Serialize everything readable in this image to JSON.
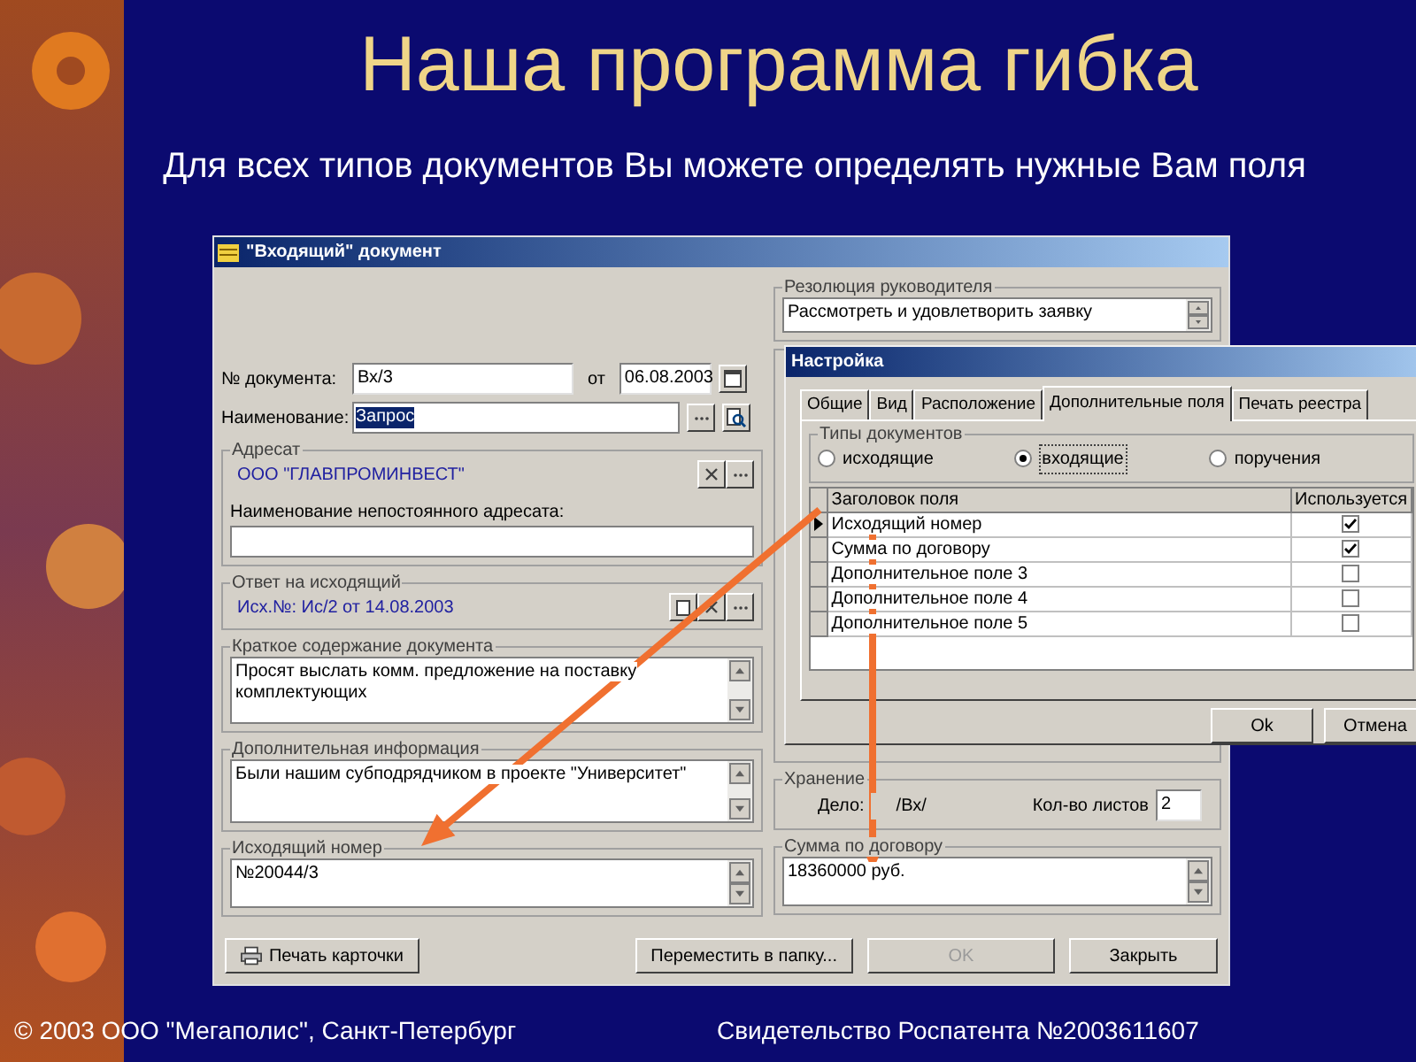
{
  "slide": {
    "title": "Наша программа гибка",
    "subtitle": "Для всех типов документов Вы можете определять нужные Вам поля",
    "footer_left": "© 2003 ООО \"Мегаполис\", Санкт-Петербург",
    "footer_right": "Свидетельство Роспатента №2003611607"
  },
  "main_window": {
    "title": "\"Входящий\" документ",
    "doc_number": {
      "label": "№ документа:",
      "value": "Вх/3"
    },
    "date": {
      "label": "от",
      "value": "06.08.2003"
    },
    "name": {
      "label": "Наименование:",
      "value": "Запрос"
    },
    "addressee": {
      "legend": "Адресат",
      "value": "ООО \"ГЛАВПРОМИНВЕСТ\"",
      "temp_label": "Наименование непостоянного адресата:"
    },
    "reply": {
      "legend": "Ответ на исходящий",
      "value": "Исх.№:  Ис/2 от 14.08.2003"
    },
    "summary": {
      "legend": "Краткое содержание документа",
      "text": "Просят выслать комм. предложение на поставку комплектующих"
    },
    "extra_info": {
      "legend": "Дополнительная информация",
      "text": "Были нашим субподрядчиком в проекте \"Университет\""
    },
    "outgoing_number": {
      "legend": "Исходящий номер",
      "text": "№20044/3"
    },
    "resolution": {
      "legend": "Резолюция руководителя",
      "text": "Рассмотреть и удовлетворить заявку"
    },
    "storage": {
      "legend": "Хранение",
      "case_label": "Дело:",
      "case_value": "/Вх/",
      "sheets_label": "Кол-во листов",
      "sheets_value": "2"
    },
    "contract_sum": {
      "legend": "Сумма по договору",
      "text": "18360000 руб."
    },
    "buttons": [
      {
        "label": "Печать карточки",
        "kind": "print",
        "disabled": false
      },
      {
        "label": "Переместить в папку...",
        "kind": "plain",
        "disabled": false
      },
      {
        "label": "OK",
        "kind": "plain",
        "disabled": true
      },
      {
        "label": "Закрыть",
        "kind": "plain",
        "disabled": false
      }
    ]
  },
  "settings_dialog": {
    "title": "Настройка",
    "tabs": [
      {
        "label": "Общие",
        "selected": false
      },
      {
        "label": "Вид",
        "selected": false
      },
      {
        "label": "Расположение",
        "selected": false
      },
      {
        "label": "Дополнительные поля",
        "selected": true
      },
      {
        "label": "Печать реестра",
        "selected": false
      }
    ],
    "doc_types": {
      "legend": "Типы документов",
      "options": [
        {
          "label": "исходящие",
          "selected": false
        },
        {
          "label": "входящие",
          "selected": true
        },
        {
          "label": "поручения",
          "selected": false
        }
      ]
    },
    "grid": {
      "columns": [
        "Заголовок поля",
        "Используется"
      ],
      "rows": [
        {
          "label": "Исходящий номер",
          "checked": true,
          "selected": true
        },
        {
          "label": "Сумма по договору",
          "checked": true,
          "selected": false
        },
        {
          "label": "Дополнительное поле 3",
          "checked": false,
          "selected": false
        },
        {
          "label": "Дополнительное поле 4",
          "checked": false,
          "selected": false
        },
        {
          "label": "Дополнительное поле 5",
          "checked": false,
          "selected": false
        }
      ]
    },
    "buttons": [
      "Ok",
      "Отмена"
    ]
  }
}
